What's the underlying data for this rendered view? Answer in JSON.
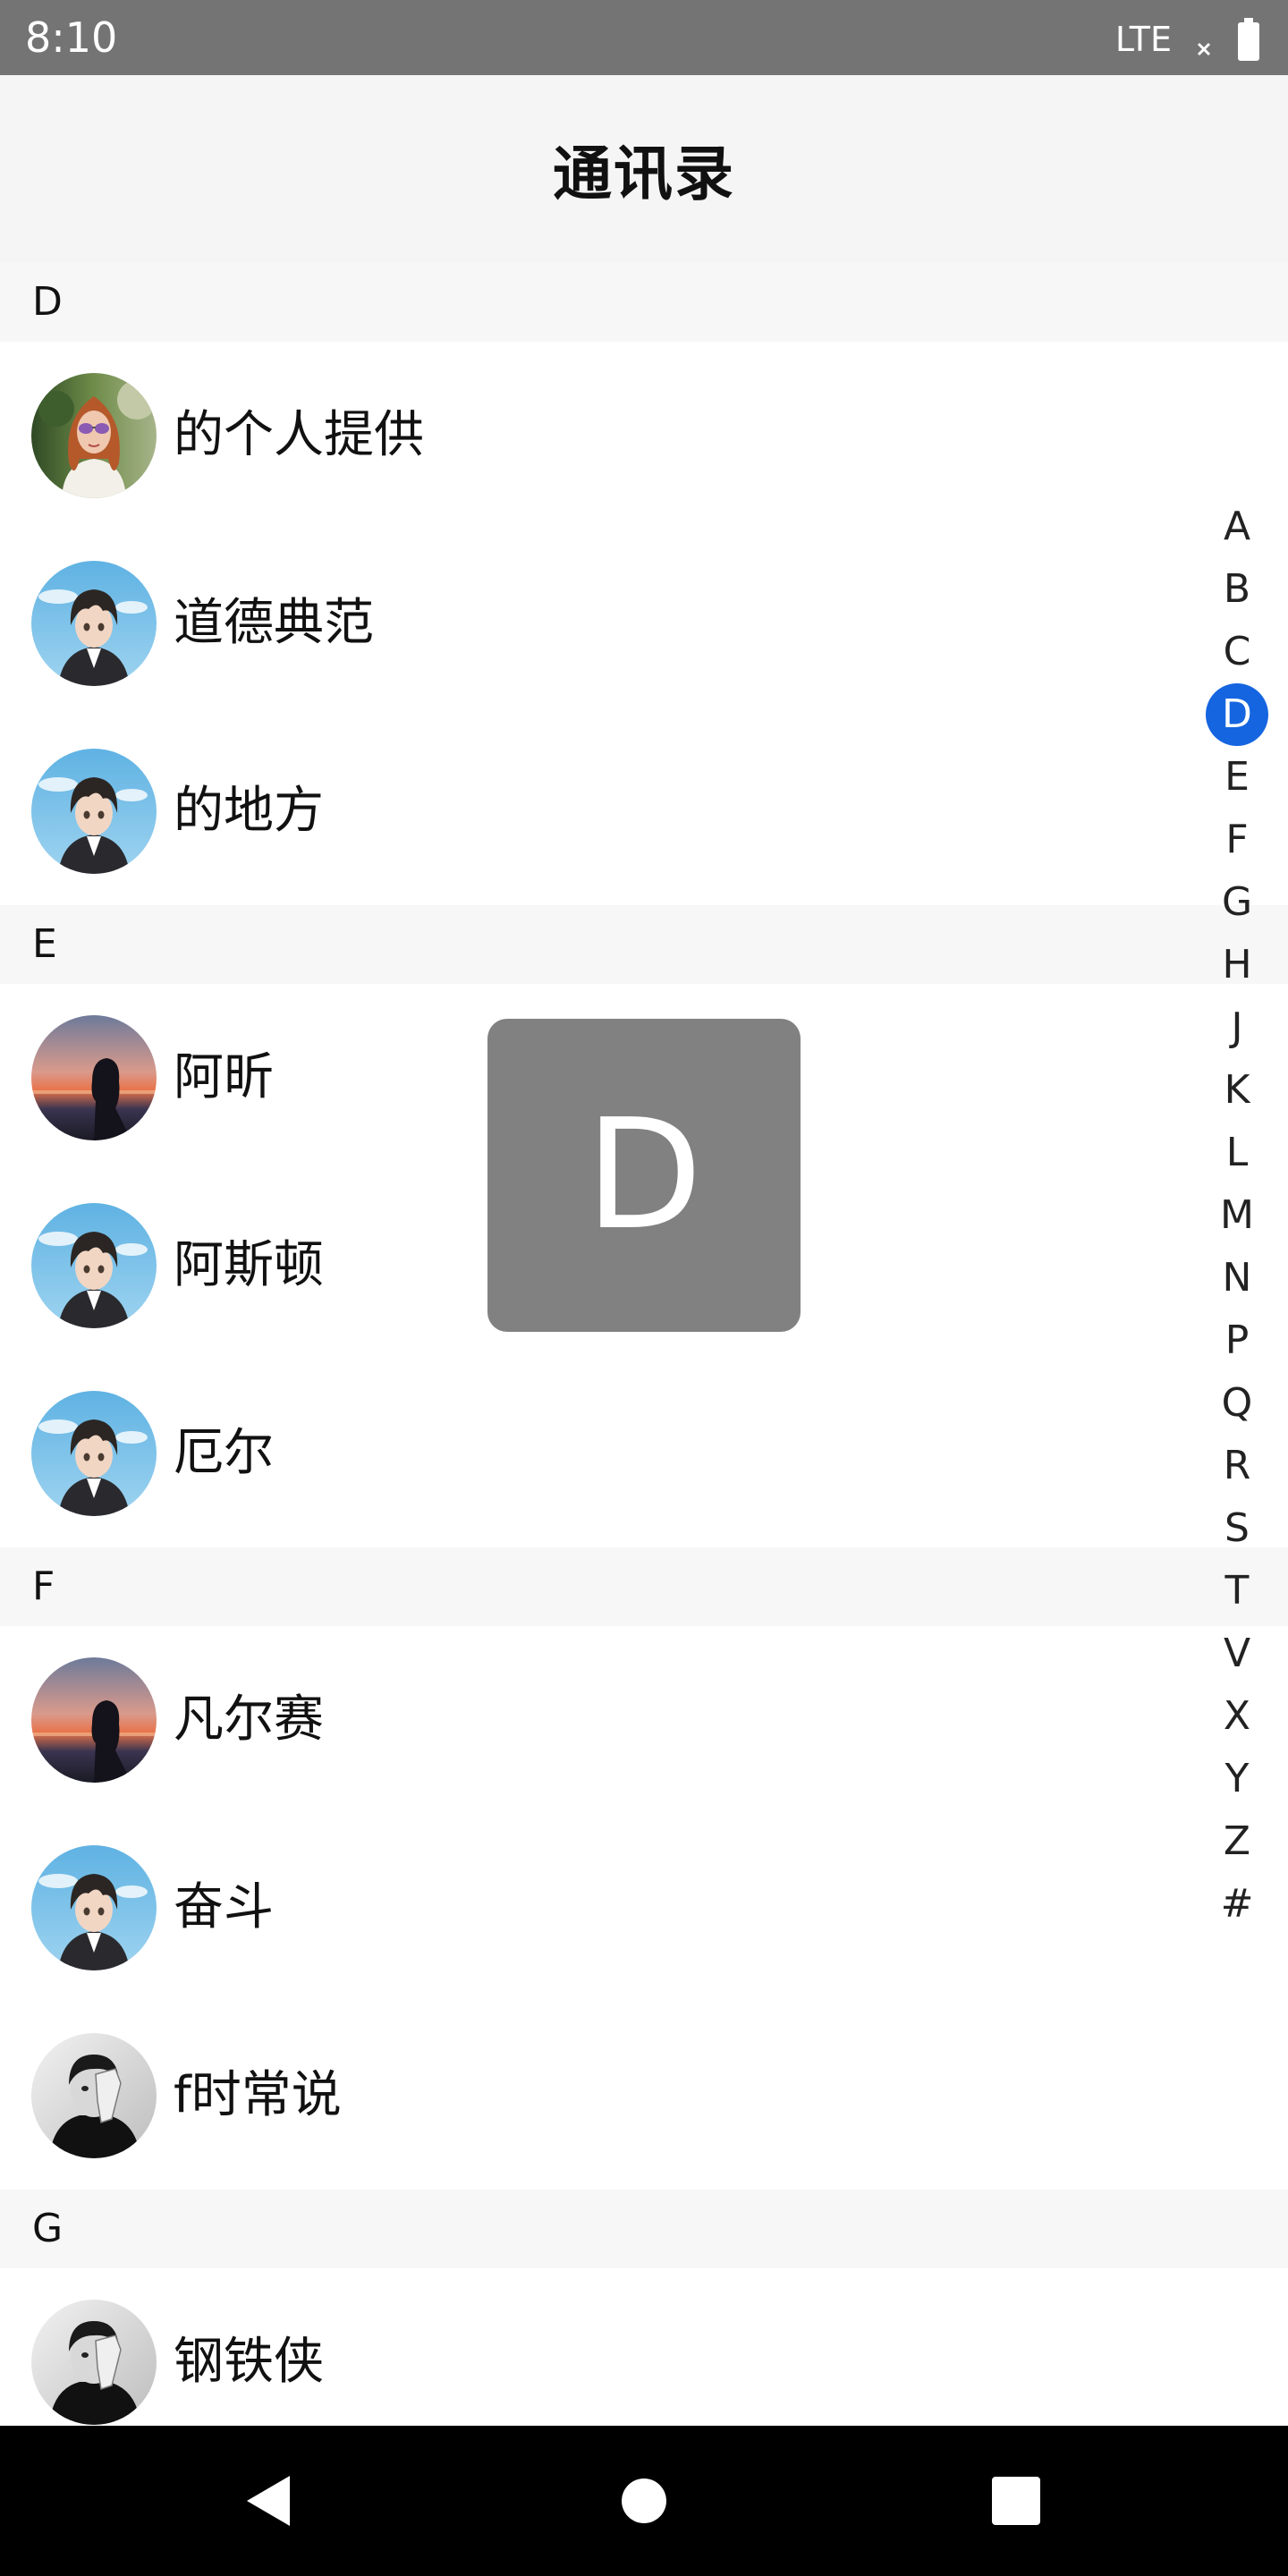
{
  "status_bar": {
    "time": "8:10",
    "network": "LTE",
    "signal_icon": "signal-off-icon",
    "battery_icon": "battery-icon"
  },
  "header": {
    "title": "通讯录"
  },
  "sections": [
    {
      "letter": "D",
      "contacts": [
        {
          "name": "的个人提供",
          "avatar": "girl-sunglasses"
        },
        {
          "name": "道德典范",
          "avatar": "anime-boy"
        },
        {
          "name": "的地方",
          "avatar": "anime-boy"
        }
      ]
    },
    {
      "letter": "E",
      "contacts": [
        {
          "name": "阿昕",
          "avatar": "sunset-silhouette"
        },
        {
          "name": "阿斯顿",
          "avatar": "anime-boy"
        },
        {
          "name": "厄尔",
          "avatar": "anime-boy"
        }
      ]
    },
    {
      "letter": "F",
      "contacts": [
        {
          "name": "凡尔赛",
          "avatar": "sunset-silhouette"
        },
        {
          "name": "奋斗",
          "avatar": "anime-boy"
        },
        {
          "name": "f时常说",
          "avatar": "bw-portrait"
        }
      ]
    },
    {
      "letter": "G",
      "contacts": [
        {
          "name": "钢铁侠",
          "avatar": "bw-portrait"
        }
      ]
    }
  ],
  "alphabet_index": {
    "letters": [
      "A",
      "B",
      "C",
      "D",
      "E",
      "F",
      "G",
      "H",
      "J",
      "K",
      "L",
      "M",
      "N",
      "P",
      "Q",
      "R",
      "S",
      "T",
      "V",
      "X",
      "Y",
      "Z",
      "#"
    ],
    "active": "D",
    "active_color": "#1565e0"
  },
  "letter_overlay": {
    "letter": "D"
  },
  "nav_bar": {
    "icons": [
      "back-icon",
      "home-icon",
      "recents-icon"
    ]
  },
  "colors": {
    "status_bar": "#747474",
    "title_bar": "#f5f5f5",
    "section_header": "#f7f7f7",
    "overlay": "#818181",
    "nav_bar": "#000000"
  }
}
